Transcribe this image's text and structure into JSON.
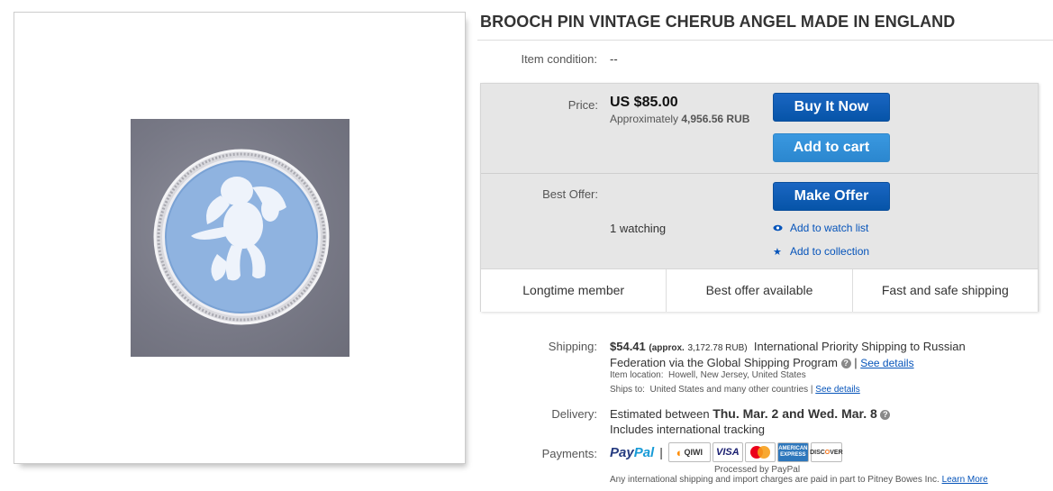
{
  "listing": {
    "title": "BROOCH PIN VINTAGE CHERUB ANGEL MADE IN ENGLAND"
  },
  "condition": {
    "label": "Item condition:",
    "value": "--"
  },
  "price": {
    "label": "Price:",
    "value": "US $85.00",
    "approx_prefix": "Approximately",
    "approx_value": "4,956.56 RUB"
  },
  "buttons": {
    "buy_now": "Buy It Now",
    "add_to_cart": "Add to cart",
    "make_offer": "Make Offer"
  },
  "best_offer": {
    "label": "Best Offer:"
  },
  "watching": "1 watching",
  "links": {
    "watch_list": "Add to watch list",
    "collection": "Add to collection"
  },
  "features": [
    "Longtime member",
    "Best offer available",
    "Fast and safe shipping"
  ],
  "shipping": {
    "label": "Shipping:",
    "cost": "$54.41",
    "approx": "(approx.",
    "approx_value": "3,172.78 RUB)",
    "service": "International Priority Shipping to Russian",
    "service_line2": "Federation  via the Global Shipping Program",
    "see_details": "See details",
    "location_label": "Item location:",
    "location": "Howell, New Jersey, United States",
    "ships_to_label": "Ships to:",
    "ships_to": "United States and many other countries",
    "ships_to_details": "See details"
  },
  "delivery": {
    "label": "Delivery:",
    "prefix": "Estimated between",
    "range": "Thu. Mar. 2 and Wed. Mar. 8",
    "tracking": "Includes international tracking"
  },
  "payments": {
    "label": "Payments:",
    "paypal_a": "Pay",
    "paypal_b": "Pal",
    "qiwi": "QIWI",
    "visa": "VISA",
    "amex": "AMERICAN EXPRESS",
    "discover_a": "DISC",
    "discover_o": "O",
    "discover_b": "VER",
    "processed": "Processed by PayPal",
    "footnote": "Any international shipping and import charges are paid in part to Pitney Bowes Inc.",
    "learn_more": "Learn More"
  },
  "colors": {
    "button_dark": "#0654a8",
    "button_light": "#2b87cf",
    "link": "#0654ba",
    "jasper_blue": "#8fb3e0"
  },
  "icons": [
    "eye-icon",
    "star-icon",
    "help-icon",
    "paypal-logo",
    "qiwi-logo",
    "visa-logo",
    "mastercard-logo",
    "amex-logo",
    "discover-logo"
  ]
}
